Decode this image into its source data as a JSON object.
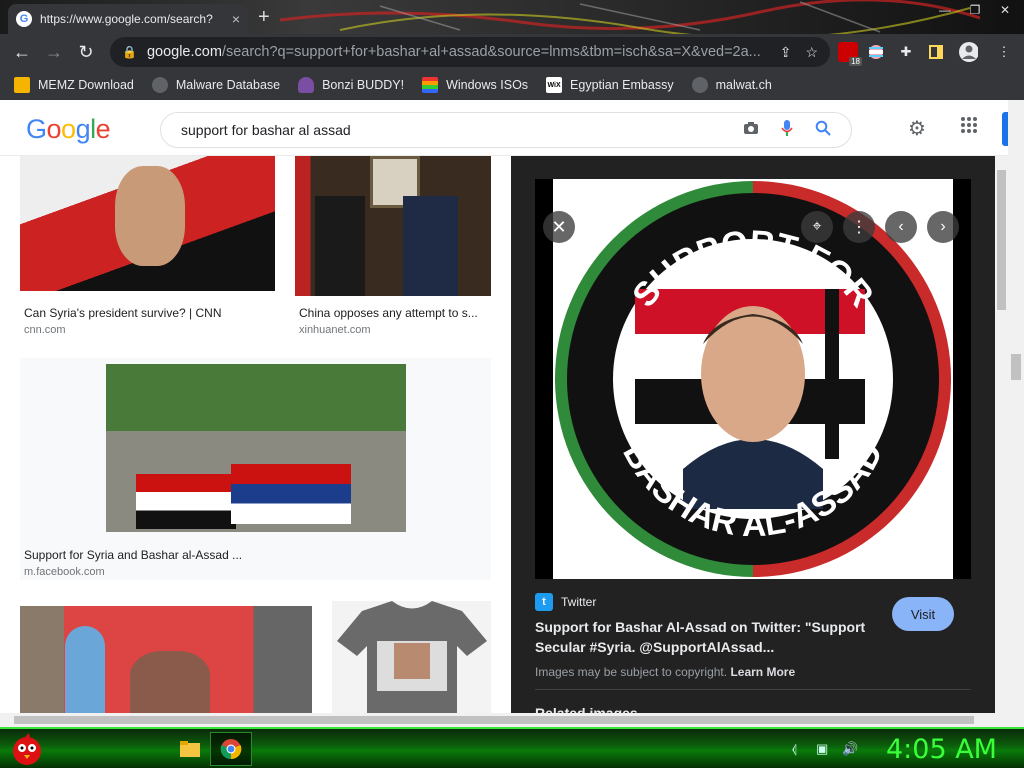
{
  "tab": {
    "title": "https://www.google.com/search?",
    "close": "×"
  },
  "newtab": "+",
  "window": {
    "min": "—",
    "max": "❐",
    "close": "✕"
  },
  "omnibox": {
    "domain": "google.com",
    "path": "/search?q=support+for+bashar+al+assad&source=lnms&tbm=isch&sa=X&ved=2a..."
  },
  "extensions": {
    "ublock_badge": "18"
  },
  "bookmarks": [
    {
      "label": "MEMZ Download",
      "icon": "folder-icon"
    },
    {
      "label": "Malware Database",
      "icon": "globe-icon"
    },
    {
      "label": "Bonzi BUDDY!",
      "icon": "bonzi-icon"
    },
    {
      "label": "Windows ISOs",
      "icon": "windows-icon"
    },
    {
      "label": "Egyptian Embassy",
      "icon": "wix-icon"
    },
    {
      "label": "malwat.ch",
      "icon": "globe-icon"
    }
  ],
  "search": {
    "query": "support for bashar al assad"
  },
  "results": [
    {
      "title": "Can Syria's president survive? | CNN",
      "source": "cnn.com"
    },
    {
      "title": "China opposes any attempt to s...",
      "source": "xinhuanet.com"
    },
    {
      "title": "Support for Syria and Bashar al-Assad ...",
      "source": "m.facebook.com"
    }
  ],
  "preview": {
    "image_top_text": "SUPPORT FOR",
    "image_bottom_text": "BASHAR AL-ASSAD",
    "source_name": "Twitter",
    "title": "Support for Bashar Al-Assad on Twitter: \"Support Secular #Syria. @SupportAlAssad...",
    "visit_label": "Visit",
    "copyright_text": "Images may be subject to copyright.",
    "learn_more": "Learn More",
    "related_label": "Related images"
  },
  "taskbar": {
    "clock": "4:05 AM"
  },
  "colors": {
    "google_blue": "#4285f4",
    "google_red": "#ea4335",
    "google_yellow": "#fbbc05",
    "google_green": "#34a853",
    "visit_button": "#8ab4f8",
    "clock": "#39ff39"
  }
}
